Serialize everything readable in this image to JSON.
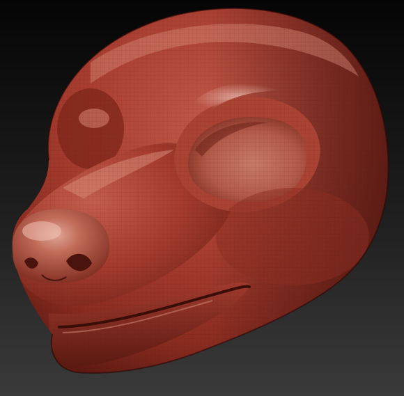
{
  "viewport": {
    "subject": "sculpted-animal-head-mask",
    "background_gradient": [
      "#050505",
      "#1f1f1f",
      "#3a3a3a"
    ],
    "material_colors": {
      "base": "#9a3528",
      "mid": "#b24a3a",
      "light": "#c9705f",
      "highlight": "#e7b3a6",
      "shadow": "#5a1a12",
      "deep_shadow": "#3a0d08"
    },
    "wireframe": true
  }
}
